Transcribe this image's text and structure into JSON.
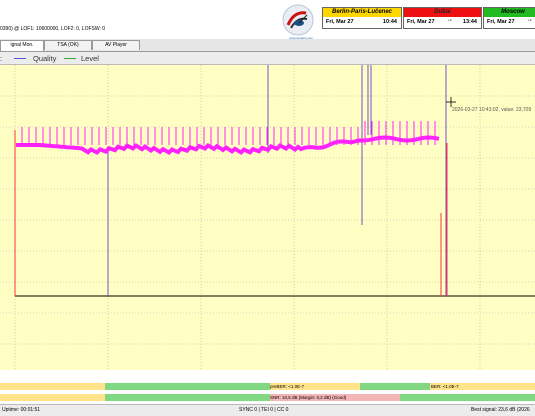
{
  "header": {
    "info_text": "0390) @ LOF1: 10600000, LOF2: 0, LOFSW: 0",
    "logo_caption": "www.dxsatcs.com"
  },
  "clocks": [
    {
      "name": "Berlin-Paris-Lučenec",
      "date": "Fri, Mar 27",
      "time": "10:44",
      "marker": "",
      "color": "#ffd700"
    },
    {
      "name": "Dubai",
      "date": "Fri, Mar 27",
      "time": "13:44",
      "marker": "+3",
      "color": "#ee1111"
    },
    {
      "name": "Moscow",
      "date": "Fri, Mar 27",
      "time": "",
      "marker": "+2",
      "color": "#22bb22"
    }
  ],
  "tabs": [
    {
      "label": "ignal Mon.",
      "active": true
    },
    {
      "label": "TSA (OK)",
      "active": false
    },
    {
      "label": "AV Player",
      "active": false
    }
  ],
  "legend": [
    {
      "label": "Quality",
      "color": "#5555dd"
    },
    {
      "label": "Level",
      "color": "#33aa33"
    }
  ],
  "tooltip": "2026-03-27 10:43:02, value: 23,709",
  "bars": {
    "prebeer": "preBER: <1.0E-7",
    "ber": "BER: <1.0E-7",
    "snr": "SNR: 10,5 dB (Margin: 0,2 dB) (Good)"
  },
  "status": {
    "uptime": "Uptime: 00:01:51",
    "sync": "SYNC 0 | TEI 0 | CC 0",
    "best": "Best signal: 23,6 dB (2026"
  }
}
